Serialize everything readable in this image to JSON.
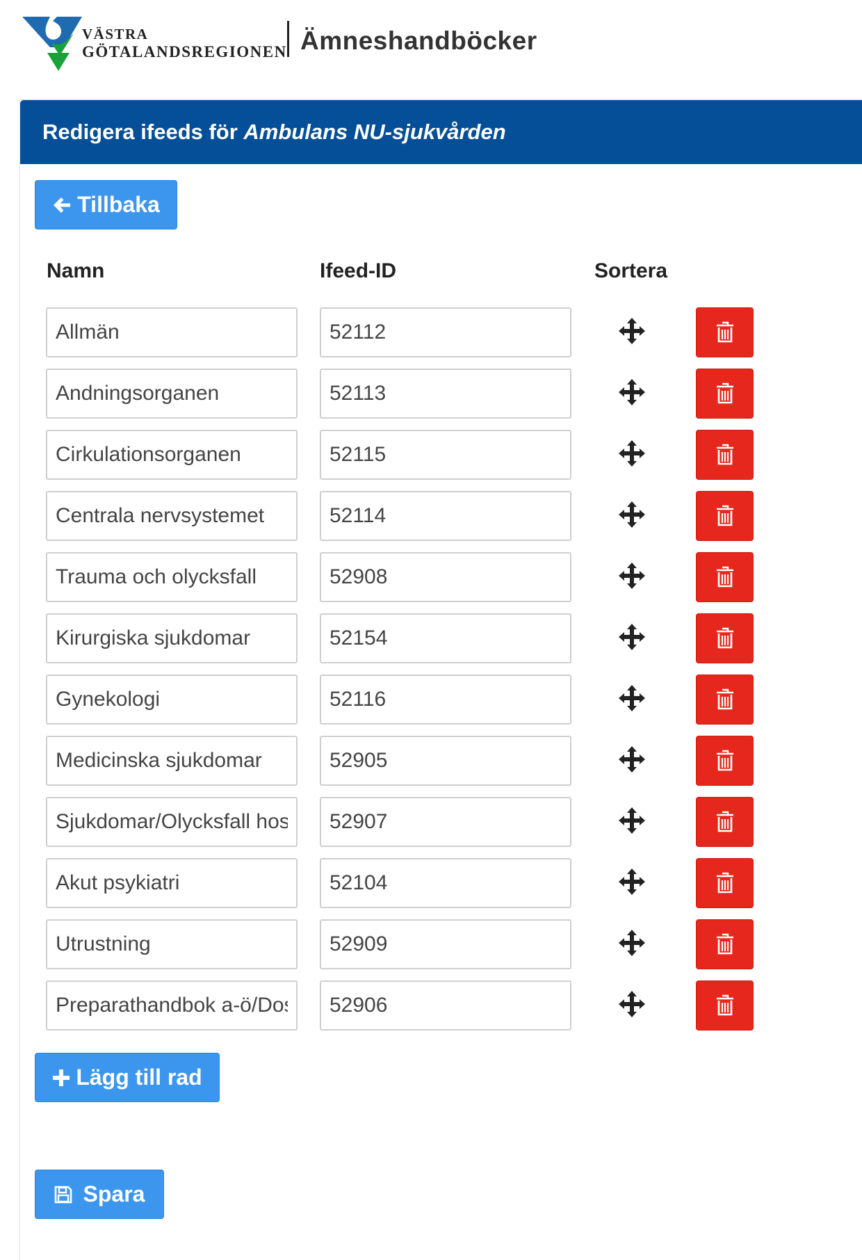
{
  "header": {
    "org_line1": "VÄSTRA",
    "org_line2": "GÖTALANDSREGIONEN",
    "app_title": "Ämneshandböcker",
    "logo_icon": "vgr-logo"
  },
  "panel": {
    "heading_prefix": "Redigera ifeeds för ",
    "heading_subject": "Ambulans NU-sjukvården",
    "back_button": {
      "label": "Tillbaka",
      "icon": "arrow-left-icon"
    },
    "columns": {
      "name": "Namn",
      "id": "Ifeed-ID",
      "sort": "Sortera"
    },
    "rows": [
      {
        "name": "Allmän",
        "id": "52112"
      },
      {
        "name": "Andningsorganen",
        "id": "52113"
      },
      {
        "name": "Cirkulationsorganen",
        "id": "52115"
      },
      {
        "name": "Centrala nervsystemet",
        "id": "52114"
      },
      {
        "name": "Trauma och olycksfall",
        "id": "52908"
      },
      {
        "name": "Kirurgiska sjukdomar",
        "id": "52154"
      },
      {
        "name": "Gynekologi",
        "id": "52116"
      },
      {
        "name": "Medicinska sjukdomar",
        "id": "52905"
      },
      {
        "name": "Sjukdomar/Olycksfall hos barn",
        "id": "52907"
      },
      {
        "name": "Akut psykiatri",
        "id": "52104"
      },
      {
        "name": "Utrustning",
        "id": "52909"
      },
      {
        "name": "Preparathandbok a-ö/Dosering",
        "id": "52906"
      }
    ],
    "add_button": {
      "label": "Lägg till rad",
      "icon": "plus-icon"
    },
    "save_button": {
      "label": "Spara",
      "icon": "floppy-disk-icon"
    }
  },
  "colors": {
    "heading_bg": "#054f98",
    "primary_button": "#3c96ee",
    "danger_button": "#e5271d",
    "logo_blue": "#1e6bb1",
    "logo_green": "#19a23a"
  }
}
